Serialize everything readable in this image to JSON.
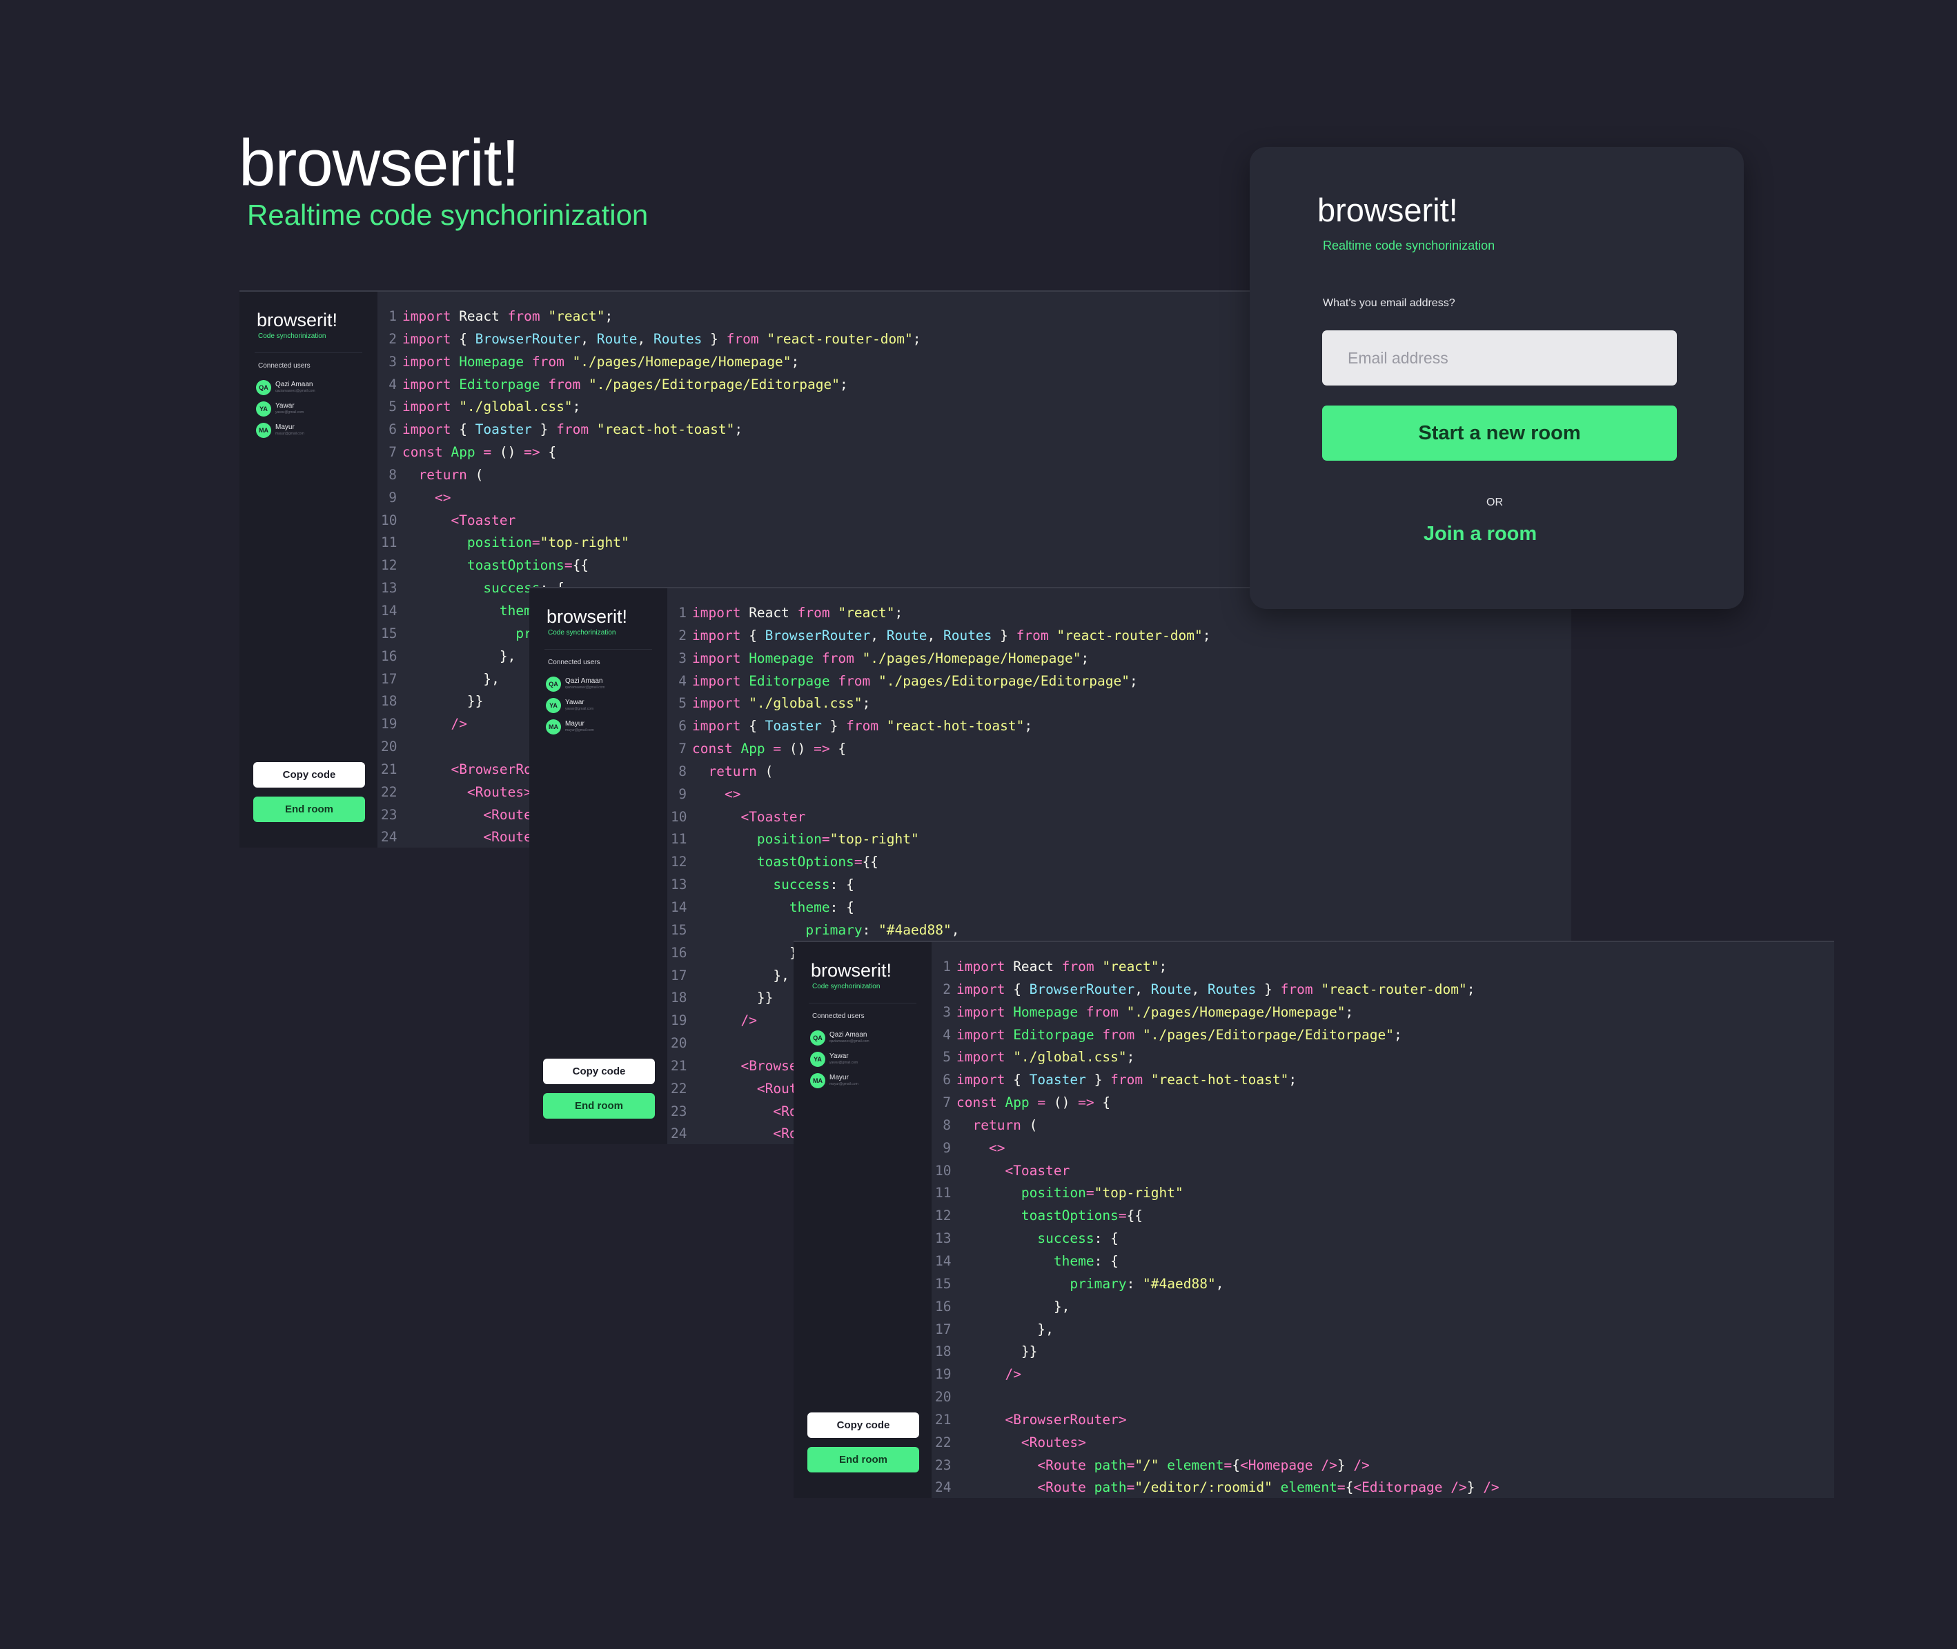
{
  "hero": {
    "title": "browserit!",
    "subtitle": "Realtime code synchorinization"
  },
  "editor": {
    "brand": "browserit!",
    "tagline": "Code synchorinization",
    "connected_label": "Connected users",
    "users": [
      {
        "initials": "QA",
        "name": "Qazi Amaan",
        "email": "qaziamaanex@gmail.com"
      },
      {
        "initials": "YA",
        "name": "Yawar",
        "email": "yawar@gmail.com"
      },
      {
        "initials": "MA",
        "name": "Mayur",
        "email": "mayur@gmail.com"
      }
    ],
    "copy_button": "Copy code",
    "end_button": "End room",
    "code_lines": [
      [
        "1",
        [
          [
            "kw",
            "import "
          ],
          [
            "",
            "React "
          ],
          [
            "kw",
            "from "
          ],
          [
            "st",
            "\"react\""
          ],
          [
            "",
            ";"
          ]
        ]
      ],
      [
        "2",
        [
          [
            "kw",
            "import "
          ],
          [
            "",
            "{ "
          ],
          [
            "ic",
            "BrowserRouter"
          ],
          [
            "",
            ", "
          ],
          [
            "ic",
            "Route"
          ],
          [
            "",
            ", "
          ],
          [
            "ic",
            "Routes"
          ],
          [
            "",
            " } "
          ],
          [
            "kw",
            "from "
          ],
          [
            "st",
            "\"react-router-dom\""
          ],
          [
            "",
            ";"
          ]
        ]
      ],
      [
        "3",
        [
          [
            "kw",
            "import "
          ],
          [
            "fn",
            "Homepage "
          ],
          [
            "kw",
            "from "
          ],
          [
            "st",
            "\"./pages/Homepage/Homepage\""
          ],
          [
            "",
            ";"
          ]
        ]
      ],
      [
        "4",
        [
          [
            "kw",
            "import "
          ],
          [
            "fn",
            "Editorpage "
          ],
          [
            "kw",
            "from "
          ],
          [
            "st",
            "\"./pages/Editorpage/Editorpage\""
          ],
          [
            "",
            ";"
          ]
        ]
      ],
      [
        "5",
        [
          [
            "kw",
            "import "
          ],
          [
            "st",
            "\"./global.css\""
          ],
          [
            "",
            ";"
          ]
        ]
      ],
      [
        "6",
        [
          [
            "kw",
            "import "
          ],
          [
            "",
            "{ "
          ],
          [
            "ic",
            "Toaster"
          ],
          [
            "",
            " } "
          ],
          [
            "kw",
            "from "
          ],
          [
            "st",
            "\"react-hot-toast\""
          ],
          [
            "",
            ";"
          ]
        ]
      ],
      [
        "7",
        [
          [
            "kw",
            "const "
          ],
          [
            "fn",
            "App "
          ],
          [
            "kw",
            "= "
          ],
          [
            "",
            "() "
          ],
          [
            "kw",
            "=> "
          ],
          [
            "",
            "{"
          ]
        ]
      ],
      [
        "8",
        [
          [
            "",
            "  "
          ],
          [
            "kw",
            "return "
          ],
          [
            "",
            "("
          ]
        ]
      ],
      [
        "9",
        [
          [
            "",
            "    "
          ],
          [
            "tg",
            "<>"
          ]
        ]
      ],
      [
        "10",
        [
          [
            "",
            "      "
          ],
          [
            "tg",
            "<Toaster"
          ]
        ]
      ],
      [
        "11",
        [
          [
            "",
            "        "
          ],
          [
            "at",
            "position"
          ],
          [
            "kw",
            "="
          ],
          [
            "st",
            "\"top-right\""
          ]
        ]
      ],
      [
        "12",
        [
          [
            "",
            "        "
          ],
          [
            "at",
            "toastOptions"
          ],
          [
            "kw",
            "="
          ],
          [
            "",
            "{{"
          ]
        ]
      ],
      [
        "13",
        [
          [
            "",
            "          "
          ],
          [
            "at",
            "success"
          ],
          [
            "",
            ": {"
          ]
        ]
      ],
      [
        "14",
        [
          [
            "",
            "            "
          ],
          [
            "at",
            "theme"
          ],
          [
            "",
            ": {"
          ]
        ]
      ],
      [
        "15",
        [
          [
            "",
            "              "
          ],
          [
            "at",
            "primary"
          ],
          [
            "",
            ": "
          ],
          [
            "st",
            "\"#4aed88\""
          ],
          [
            "",
            ","
          ]
        ]
      ],
      [
        "16",
        [
          [
            "",
            "            },"
          ]
        ]
      ],
      [
        "17",
        [
          [
            "",
            "          },"
          ]
        ]
      ],
      [
        "18",
        [
          [
            "",
            "        }}"
          ]
        ]
      ],
      [
        "19",
        [
          [
            "",
            "      "
          ],
          [
            "tg",
            "/>"
          ]
        ]
      ],
      [
        "20",
        [
          [
            "",
            ""
          ]
        ]
      ],
      [
        "21",
        [
          [
            "",
            "      "
          ],
          [
            "tg",
            "<BrowserRouter>"
          ]
        ]
      ],
      [
        "22",
        [
          [
            "",
            "        "
          ],
          [
            "tg",
            "<Routes>"
          ]
        ]
      ],
      [
        "23",
        [
          [
            "",
            "          "
          ],
          [
            "tg",
            "<Route "
          ],
          [
            "at",
            "path"
          ],
          [
            "kw",
            "="
          ],
          [
            "st",
            "\"/\" "
          ],
          [
            "at",
            "element"
          ],
          [
            "kw",
            "="
          ],
          [
            "",
            "{"
          ],
          [
            "tg",
            "<Homepage />"
          ],
          [
            "",
            "} "
          ],
          [
            "tg",
            "/>"
          ]
        ]
      ],
      [
        "24",
        [
          [
            "",
            "          "
          ],
          [
            "tg",
            "<Route "
          ],
          [
            "at",
            "path"
          ],
          [
            "kw",
            "="
          ],
          [
            "st",
            "\"/editor/:roomid\" "
          ],
          [
            "at",
            "element"
          ],
          [
            "kw",
            "="
          ],
          [
            "",
            "{"
          ],
          [
            "tg",
            "<Editorpage />"
          ],
          [
            "",
            "} "
          ],
          [
            "tg",
            "/>"
          ]
        ]
      ]
    ]
  },
  "login": {
    "title": "browserit!",
    "subtitle": "Realtime code synchorinization",
    "email_label": "What's you email address?",
    "email_placeholder": "Email address",
    "email_value": "",
    "start_button": "Start a new room",
    "or_text": "OR",
    "join_link": "Join a room"
  },
  "colors": {
    "background": "#21212d",
    "editor_bg": "#282a36",
    "sidebar_bg": "#1c1d27",
    "accent": "#4aed88",
    "keyword": "#ff79c6",
    "string": "#f1fa8c",
    "identifier": "#8be9fd",
    "function": "#50fa7b"
  }
}
